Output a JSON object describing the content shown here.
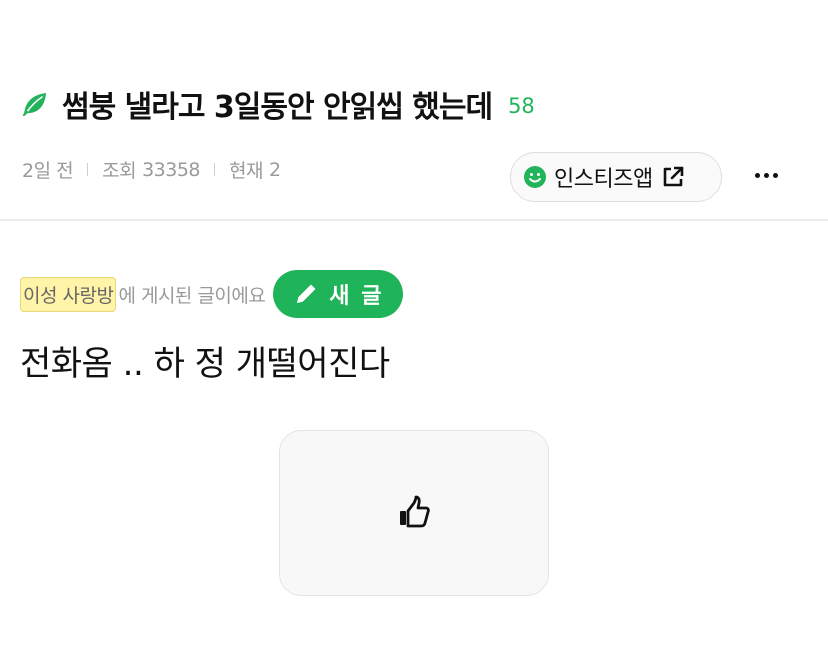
{
  "post": {
    "title": "썸붕 낼라고 3일동안 안읽씹 했는데",
    "comment_count": "58",
    "time_ago": "2일 전",
    "views_label": "조회",
    "views_value": "33358",
    "current_label": "현재",
    "current_value": "2",
    "board_name": "이성 사랑방",
    "board_suffix": "에 게시된 글이에요",
    "body": "전화옴 .. 하 정 개떨어진다"
  },
  "actions": {
    "app_button_label": "인스티즈앱",
    "new_post_label": "새 글"
  },
  "icons": {
    "title": "leaf-icon",
    "app": "smile-icon",
    "app_external": "external-link-icon",
    "more": "more-icon",
    "new_post": "pencil-icon",
    "like": "thumbs-up-icon"
  },
  "colors": {
    "accent_green": "#1fb35a",
    "board_tag_bg": "#fff4a8",
    "meta_gray": "#9a9a9a",
    "text": "#111111"
  }
}
